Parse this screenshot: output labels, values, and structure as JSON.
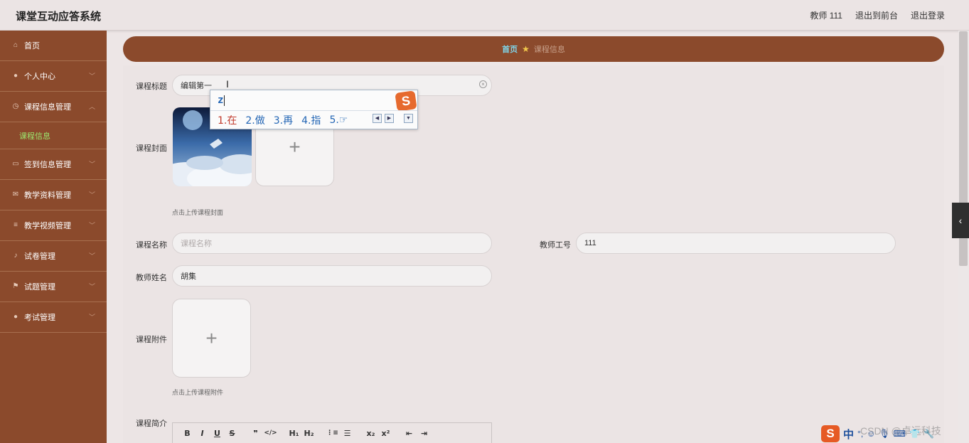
{
  "app": {
    "title": "课堂互动应答系统"
  },
  "header": {
    "user": "教师 111",
    "to_front": "退出到前台",
    "logout": "退出登录"
  },
  "sidebar": {
    "items": [
      {
        "label": "首页",
        "icon": "home-icon",
        "glyph": "⌂",
        "chevron": false
      },
      {
        "label": "个人中心",
        "icon": "user-icon",
        "glyph": "●",
        "chevron": true
      },
      {
        "label": "课程信息管理",
        "icon": "clock-icon",
        "glyph": "◷",
        "chevron": true,
        "expanded": true
      },
      {
        "label": "签到信息管理",
        "icon": "chat-icon",
        "glyph": "▭",
        "chevron": true
      },
      {
        "label": "教学资料管理",
        "icon": "mail-icon",
        "glyph": "✉",
        "chevron": true
      },
      {
        "label": "教学视频管理",
        "icon": "list-icon",
        "glyph": "≡",
        "chevron": true
      },
      {
        "label": "试卷管理",
        "icon": "mic-icon",
        "glyph": "♪",
        "chevron": true
      },
      {
        "label": "试题管理",
        "icon": "flag-icon",
        "glyph": "⚑",
        "chevron": true
      },
      {
        "label": "考试管理",
        "icon": "location-icon",
        "glyph": "●",
        "chevron": true
      }
    ],
    "submenu": {
      "label": "课程信息"
    },
    "colors": {
      "bg": "#8b4a2c",
      "active_sub": "#9be86f"
    }
  },
  "breadcrumb": {
    "home": "首页",
    "current": "课程信息"
  },
  "form": {
    "course_title": {
      "label": "课程标题",
      "value": "编辑第一"
    },
    "course_cover": {
      "label": "课程封面",
      "hint": "点击上传课程封面"
    },
    "course_name": {
      "label": "课程名称",
      "placeholder": "课程名称"
    },
    "teacher_id": {
      "label": "教师工号",
      "value": "111"
    },
    "teacher_name": {
      "label": "教师姓名",
      "value": "胡集"
    },
    "attachment": {
      "label": "课程附件",
      "hint": "点击上传课程附件"
    },
    "intro": {
      "label": "课程简介"
    }
  },
  "ime": {
    "input": "z",
    "candidates": [
      "1.在",
      "2.做",
      "3.再",
      "4.指",
      "5.☞"
    ]
  },
  "editor_toolbar": [
    "B",
    "I",
    "U",
    "S",
    "❞",
    "</>",
    "H₁",
    "H₂",
    "⋮≡",
    "☰",
    "x₂",
    "x²",
    "⇤",
    "⇥"
  ],
  "tray": {
    "zh": "中",
    "watermark": "CSDN @卓远科技"
  }
}
